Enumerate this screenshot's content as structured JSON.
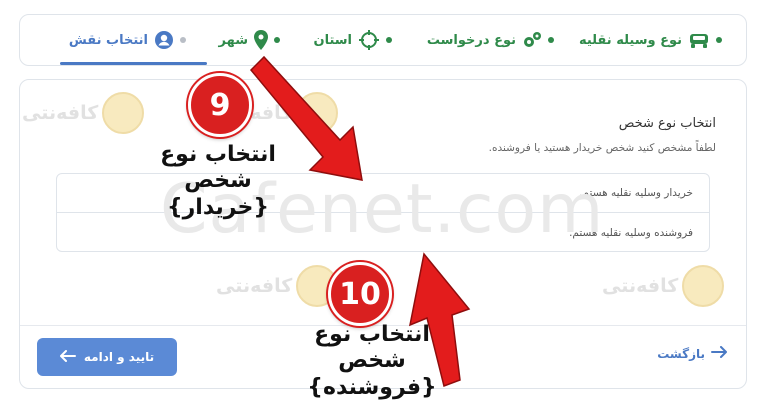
{
  "stepper": {
    "steps": [
      {
        "label": "نوع وسیله نقلیه",
        "icon": "car-icon"
      },
      {
        "label": "نوع درخواست",
        "icon": "gears-icon"
      },
      {
        "label": "استان",
        "icon": "crosshair-icon"
      },
      {
        "label": "شهر",
        "icon": "map-pin-icon"
      },
      {
        "label": "انتخاب نقش",
        "icon": "user-circle-icon"
      }
    ]
  },
  "card": {
    "title": "انتخاب نوع شخص",
    "subtitle": "لطفاً مشخص کنید شخص خریدار هستید یا فروشنده.",
    "options": [
      "خریدار وسلیه نقلیه هستم.",
      "فروشنده وسلیه نقلیه هستم."
    ],
    "confirm_label": "تایید و ادامه",
    "back_label": "بازگشت"
  },
  "watermark": {
    "brand": "کافه‌نتی",
    "site": "Cafenet.com"
  },
  "annotations": [
    {
      "number": "9",
      "line1": "انتخاب نوع شخص",
      "line2": "{خریدار}"
    },
    {
      "number": "10",
      "line1": "انتخاب نوع شخص",
      "line2": "{فروشنده}"
    }
  ],
  "colors": {
    "step_done": "#2f8a4a",
    "step_active": "#4a79c4",
    "primary_button": "#5b8ad6",
    "badge_red": "#d92020"
  }
}
